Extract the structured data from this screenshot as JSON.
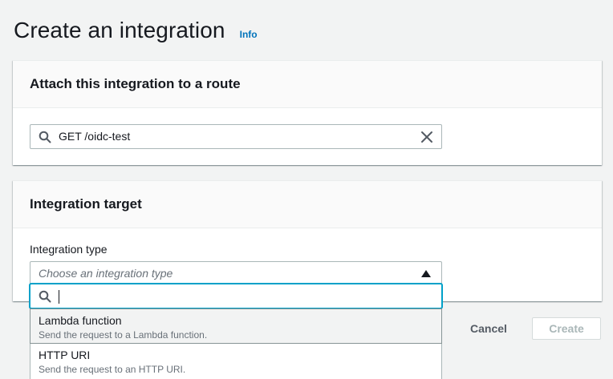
{
  "page": {
    "title": "Create an integration",
    "info_link": "Info"
  },
  "route_section": {
    "title": "Attach this integration to a route",
    "search": {
      "value": "GET /oidc-test",
      "icon": "search-icon",
      "clear_icon": "close-icon"
    }
  },
  "target_section": {
    "title": "Integration target",
    "integration_type": {
      "label": "Integration type",
      "placeholder": "Choose an integration type",
      "expanded": true,
      "filter_value": "",
      "options": [
        {
          "label": "Lambda function",
          "description": "Send the request to a Lambda function.",
          "highlighted": true
        },
        {
          "label": "HTTP URI",
          "description": "Send the request to an HTTP URI.",
          "highlighted": false
        }
      ]
    }
  },
  "actions": {
    "cancel_label": "Cancel",
    "create_label": "Create",
    "create_disabled": true
  },
  "colors": {
    "page_bg": "#f2f3f3",
    "link": "#0073bb",
    "focus_ring": "#00a1c9",
    "disabled_text": "#aab7b8"
  }
}
